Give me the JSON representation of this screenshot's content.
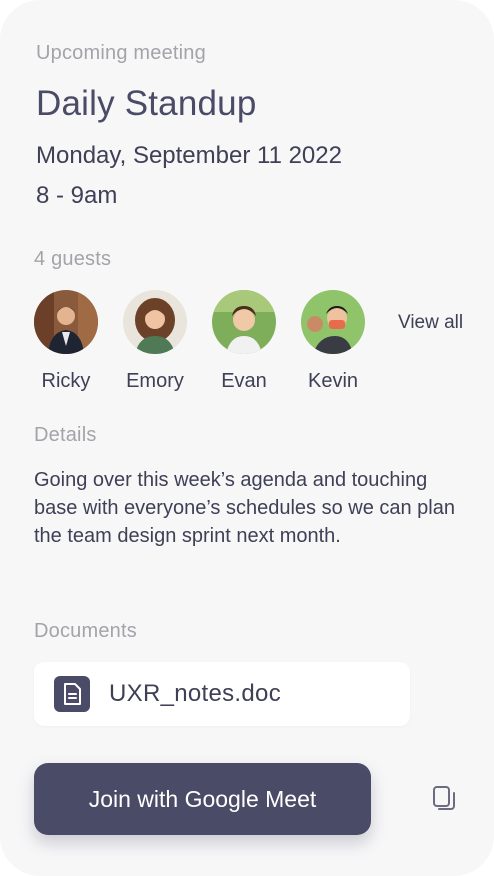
{
  "meeting": {
    "upcoming_label": "Upcoming meeting",
    "title": "Daily Standup",
    "date": "Monday, September 11 2022",
    "time": "8 - 9am"
  },
  "guests": {
    "count_label": "4 guests",
    "view_all_label": "View all",
    "items": [
      {
        "name": "Ricky"
      },
      {
        "name": "Emory"
      },
      {
        "name": "Evan"
      },
      {
        "name": "Kevin"
      }
    ]
  },
  "details": {
    "label": "Details",
    "text": "Going over this week’s agenda and touching base with everyone’s schedules so we can plan the team design sprint next month."
  },
  "documents": {
    "label": "Documents",
    "items": [
      {
        "name": "UXR_notes.doc",
        "icon": "document-icon"
      }
    ]
  },
  "actions": {
    "join_label": "Join with Google Meet",
    "copy_icon": "copy-icon"
  },
  "colors": {
    "accent": "#4a4b66",
    "background": "#f7f7f8",
    "muted_text": "#a3a4a8",
    "body_text": "#3f4056"
  }
}
